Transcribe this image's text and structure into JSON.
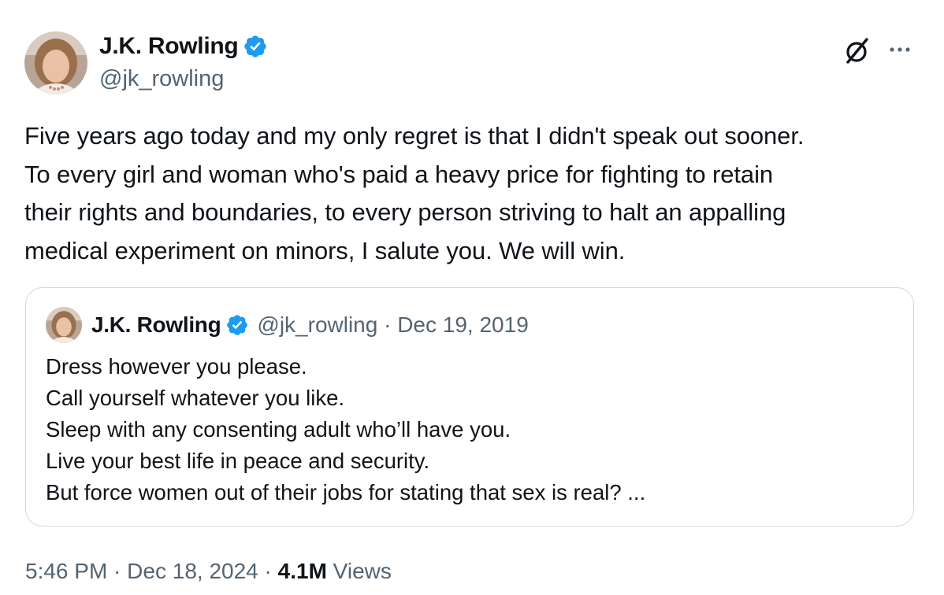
{
  "tweet": {
    "author": {
      "name": "J.K. Rowling",
      "handle": "@jk_rowling",
      "verified": true
    },
    "text_lines": [
      "Five years ago today and my only regret is that I didn't speak out sooner.",
      "To every girl and woman who's paid a heavy price for fighting to retain",
      "their rights and boundaries, to every person striving to halt an appalling",
      "medical experiment on minors, I salute you. We will win."
    ],
    "quoted": {
      "name": "J.K. Rowling",
      "meta": "@jk_rowling · Dec 19, 2019",
      "text_lines": [
        "Dress however you please.",
        "Call yourself whatever you like.",
        "Sleep with any consenting adult who’ll have you.",
        "Live your best life in peace and security.",
        "But force women out of their jobs for stating that sex is real? ..."
      ]
    },
    "footer": {
      "time": "5:46 PM",
      "date": "Dec 18, 2024",
      "separator": " · ",
      "views_count": "4.1M",
      "views_label": "Views"
    }
  },
  "icons": {
    "verified": "verified-badge-icon",
    "grok": "grok-icon",
    "more": "more-options-icon"
  },
  "colors": {
    "verified_blue": "#1d9bf0",
    "secondary_text": "#536471",
    "primary_text": "#0f1419",
    "border": "#cfd9de"
  }
}
